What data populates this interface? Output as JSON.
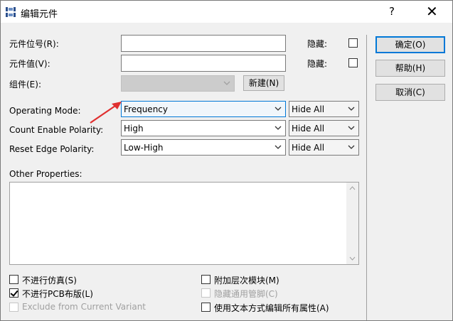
{
  "window": {
    "title": "编辑元件",
    "help_symbol": "?",
    "close_symbol": "✕"
  },
  "fields": {
    "ref_label": "元件位号(R):",
    "ref_value": "",
    "value_label": "元件值(V):",
    "value_value": "",
    "group_label": "组件(E):",
    "group_value": "",
    "new_button": "新建(N)",
    "hide_label_1": "隐藏:",
    "hide_label_2": "隐藏:"
  },
  "properties": [
    {
      "label": "Operating Mode:",
      "value": "Frequency",
      "visibility": "Hide All"
    },
    {
      "label": "Count Enable Polarity:",
      "value": "High",
      "visibility": "Hide All"
    },
    {
      "label": "Reset Edge Polarity:",
      "value": "Low-High",
      "visibility": "Hide All"
    }
  ],
  "other_properties": {
    "label": "Other Properties:",
    "value": ""
  },
  "options": {
    "exclude_sim": {
      "label": "不进行仿真(S)",
      "checked": false
    },
    "exclude_pcb": {
      "label": "不进行PCB布版(L)",
      "checked": true
    },
    "exclude_variant": {
      "label": "Exclude from Current Variant",
      "checked": false,
      "disabled": true
    },
    "attach_hier": {
      "label": "附加层次模块(M)",
      "checked": false
    },
    "hide_common_pins": {
      "label": "隐藏通用管脚(C)",
      "checked": false,
      "disabled": true
    },
    "edit_all_text": {
      "label": "使用文本方式编辑所有属性(A)",
      "checked": false
    }
  },
  "buttons": {
    "ok": "确定(O)",
    "help": "帮助(H)",
    "cancel": "取消(C)"
  },
  "colors": {
    "accent": "#0078d7",
    "annotation_arrow": "#e03030"
  }
}
